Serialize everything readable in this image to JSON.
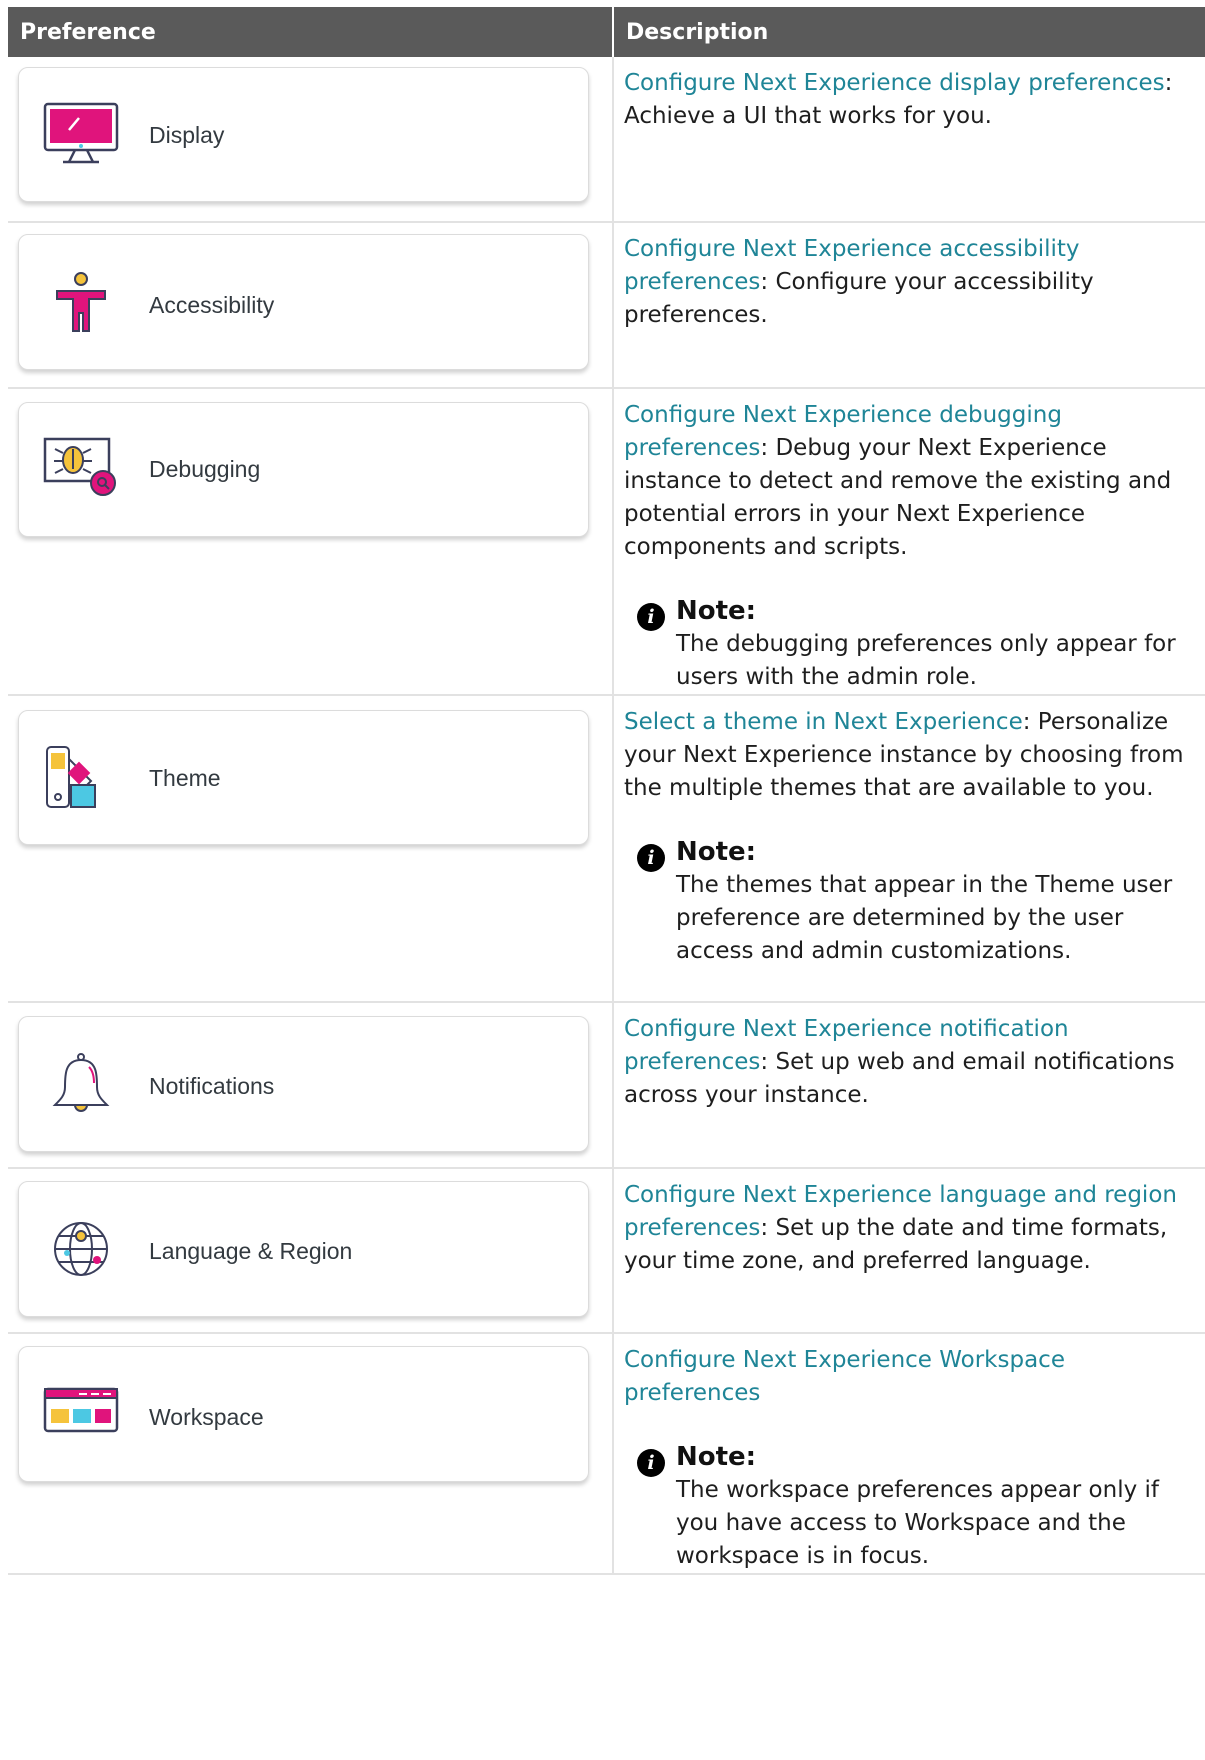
{
  "table": {
    "headers": [
      "Preference",
      "Description"
    ],
    "rows": [
      {
        "label": "Display",
        "icon": "monitor-icon",
        "link": "Configure Next Experience display preferences",
        "text": ": Achieve a UI that works for you."
      },
      {
        "label": "Accessibility",
        "icon": "accessibility-person-icon",
        "link": "Configure Next Experience accessibility preferences",
        "text": ": Configure your accessibility preferences."
      },
      {
        "label": "Debugging",
        "icon": "bug-search-icon",
        "link": "Configure Next Experience debugging preferences",
        "text": ": Debug your Next Experience instance to detect and remove the existing and potential errors in your Next Experience components and scripts.",
        "note_title": "Note:",
        "note_body": "The debugging preferences only appear for users with the admin role."
      },
      {
        "label": "Theme",
        "icon": "color-swatch-icon",
        "link": "Select a theme in Next Experience",
        "text": ": Personalize your Next Experience instance by choosing from the multiple themes that are available to you.",
        "note_title": "Note:",
        "note_body": "The themes that appear in the Theme user preference are determined by the user access and admin customizations."
      },
      {
        "label": "Notifications",
        "icon": "bell-icon",
        "link": "Configure Next Experience notification preferences",
        "text": ": Set up web and email notifications across your instance."
      },
      {
        "label": "Language & Region",
        "icon": "globe-icon",
        "link": "Configure Next Experience language and region preferences",
        "text": ": Set up the date and time formats, your time zone, and preferred language."
      },
      {
        "label": "Workspace",
        "icon": "workspace-window-icon",
        "link": "Configure Next Experience Workspace preferences",
        "text": "",
        "note_title": "Note:",
        "note_body": "The workspace preferences appear only if you have access to Workspace and the workspace is in focus."
      }
    ]
  },
  "colors": {
    "header_bg": "#5a5a5a",
    "link": "#1f8597",
    "accent_magenta": "#e0147c",
    "accent_yellow": "#f5c33b",
    "accent_cyan": "#4cc8e3"
  }
}
